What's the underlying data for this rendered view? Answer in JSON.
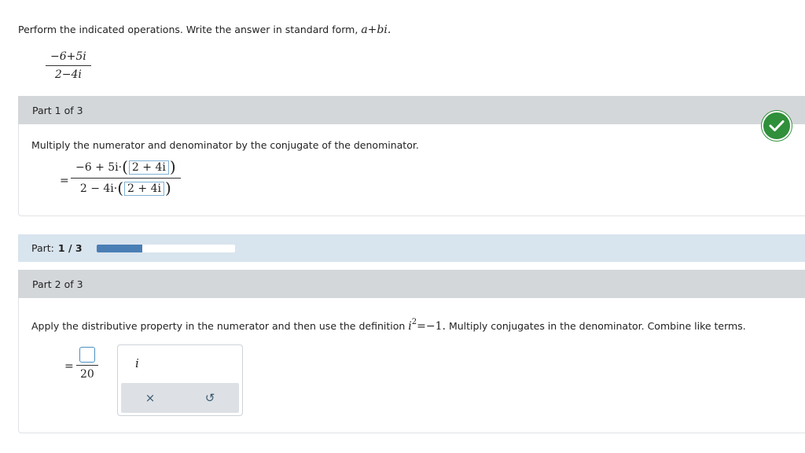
{
  "question": {
    "prompt": "Perform the indicated operations. Write the answer in standard form,",
    "form": "a+bi.",
    "numerator": "−6+5i",
    "denominator": "2−4i"
  },
  "part1": {
    "header": "Part 1 of 3",
    "instruction": "Multiply the numerator and denominator by the conjugate of the denominator.",
    "equals": "=",
    "numerator_prefix": "−6 + 5i·",
    "numerator_conjugate": "2 + 4i",
    "denominator_prefix": "2 − 4i·",
    "denominator_conjugate": "2 + 4i",
    "status": "correct"
  },
  "progress": {
    "label": "Part:",
    "value": "1 / 3",
    "fraction": 0.333
  },
  "part2": {
    "header": "Part 2 of 3",
    "instruction_a": "Apply the distributive property in the numerator and then use the definition",
    "definition_base": "i",
    "definition_exp": "2",
    "definition_rest": "=−1.",
    "instruction_b": "Multiply conjugates in the denominator. Combine like terms.",
    "equals": "=",
    "numerator_value": "",
    "denominator": "20"
  },
  "palette": {
    "symbol": "i",
    "clear_glyph": "×",
    "undo_glyph": "↺"
  },
  "colors": {
    "header_gray": "#d4d7da",
    "progress_bg": "#d8e4ee",
    "progress_fill": "#4a7fb5",
    "check_green": "#2f8f3a",
    "input_border": "#4a90c2"
  }
}
